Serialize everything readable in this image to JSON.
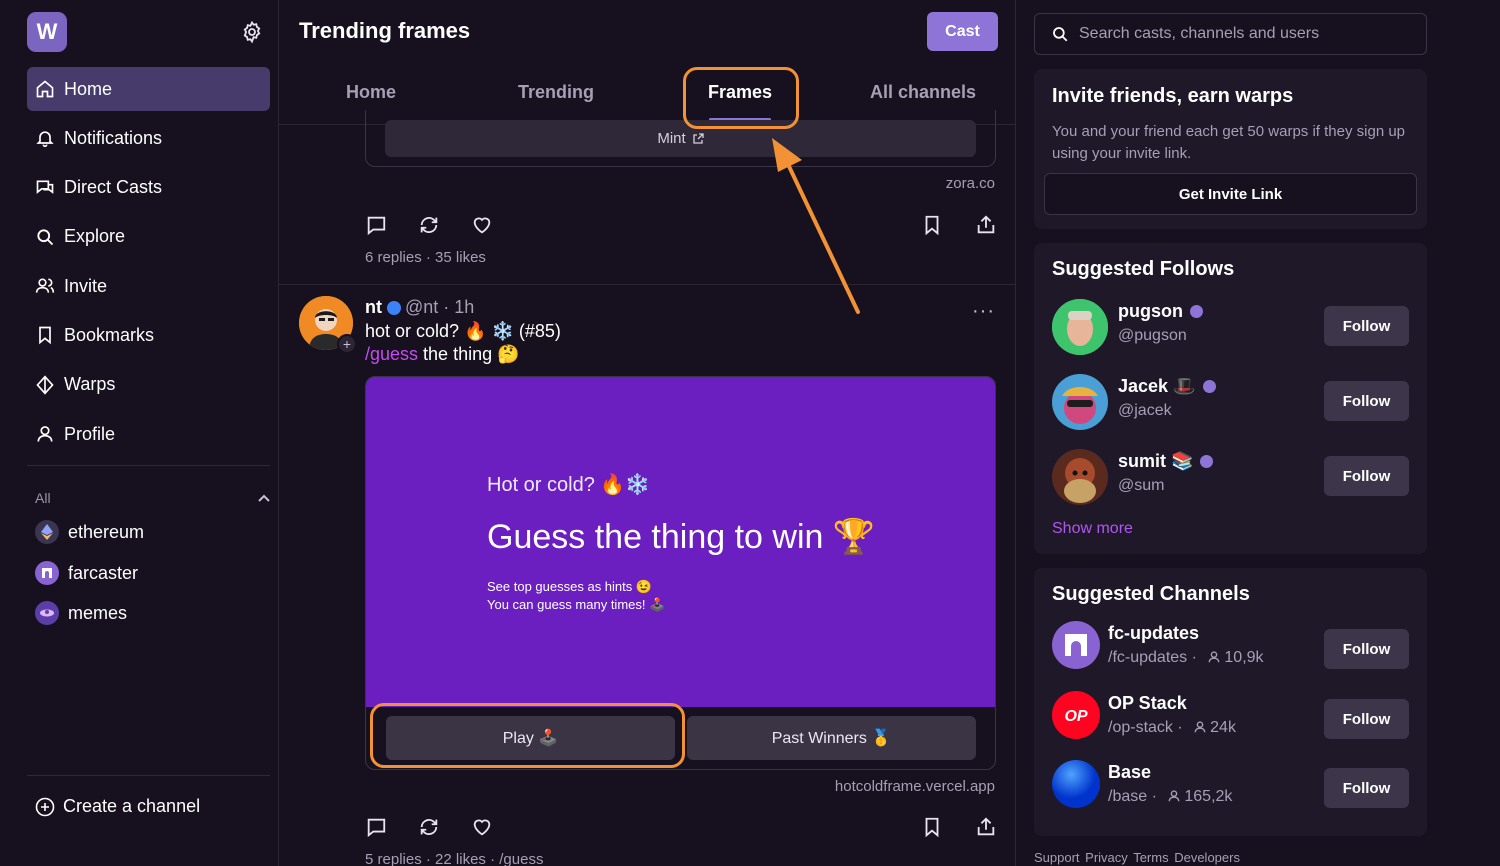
{
  "sidebar": {
    "logo": "W",
    "nav": [
      {
        "label": "Home",
        "icon": "home-icon",
        "active": true
      },
      {
        "label": "Notifications",
        "icon": "bell-icon"
      },
      {
        "label": "Direct Casts",
        "icon": "chat-icon"
      },
      {
        "label": "Explore",
        "icon": "search-icon"
      },
      {
        "label": "Invite",
        "icon": "users-icon"
      },
      {
        "label": "Bookmarks",
        "icon": "bookmark-icon"
      },
      {
        "label": "Warps",
        "icon": "diamond-icon"
      },
      {
        "label": "Profile",
        "icon": "user-icon"
      }
    ],
    "section_label": "All",
    "channels": [
      {
        "label": "ethereum",
        "color": "#6e7ec0"
      },
      {
        "label": "farcaster",
        "color": "#8a63d2"
      },
      {
        "label": "memes",
        "color": "#5b3fa8"
      }
    ],
    "create_channel": "Create a channel"
  },
  "main": {
    "title": "Trending frames",
    "cast_button": "Cast",
    "tabs": [
      "Home",
      "Trending",
      "Frames",
      "All channels"
    ],
    "active_tab": "Frames",
    "post1": {
      "mint_label": "Mint",
      "domain": "zora.co",
      "replies": "6 replies",
      "likes": "35 likes"
    },
    "post2": {
      "author": "nt",
      "handle": "@nt · 1h",
      "line1": "hot or cold? 🔥 ❄️ (#85)",
      "channel_link": "/guess",
      "line2_rest": " the thing 🤔",
      "frame": {
        "subtitle": "Hot or cold? 🔥❄️",
        "headline": "Guess the thing to win 🏆",
        "note1": "See top guesses as hints 😉",
        "note2": "You can guess many times! 🕹️",
        "button1": "Play 🕹️",
        "button2": "Past Winners 🥇"
      },
      "domain": "hotcoldframe.vercel.app",
      "replies": "5 replies",
      "likes": "22 likes",
      "channel": "/guess"
    }
  },
  "right": {
    "search_placeholder": "Search casts, channels and users",
    "invite": {
      "title": "Invite friends, earn warps",
      "desc": "You and your friend each get 50 warps if they sign up using your invite link.",
      "button": "Get Invite Link"
    },
    "follows": {
      "title": "Suggested Follows",
      "people": [
        {
          "name": "pugson",
          "handle": "@pugson",
          "emoji": "",
          "avatar": "#3ec46d"
        },
        {
          "name": "Jacek",
          "handle": "@jacek",
          "emoji": "🎩",
          "avatar": "#c78a3b"
        },
        {
          "name": "sumit",
          "handle": "@sum",
          "emoji": "📚",
          "avatar": "#8a3a24"
        }
      ],
      "follow_label": "Follow",
      "show_more": "Show more"
    },
    "channels": {
      "title": "Suggested Channels",
      "items": [
        {
          "name": "fc-updates",
          "path": "/fc-updates",
          "members": "10,9k",
          "avatar": "#8a63d2"
        },
        {
          "name": "OP Stack",
          "path": "/op-stack",
          "members": "24k",
          "avatar": "#ff0420",
          "logo": "OP"
        },
        {
          "name": "Base",
          "path": "/base",
          "members": "165,2k",
          "avatar": "#0052ff"
        }
      ],
      "follow_label": "Follow",
      "separator": "·"
    },
    "footer": [
      "Support",
      "Privacy",
      "Terms",
      "Developers"
    ]
  }
}
